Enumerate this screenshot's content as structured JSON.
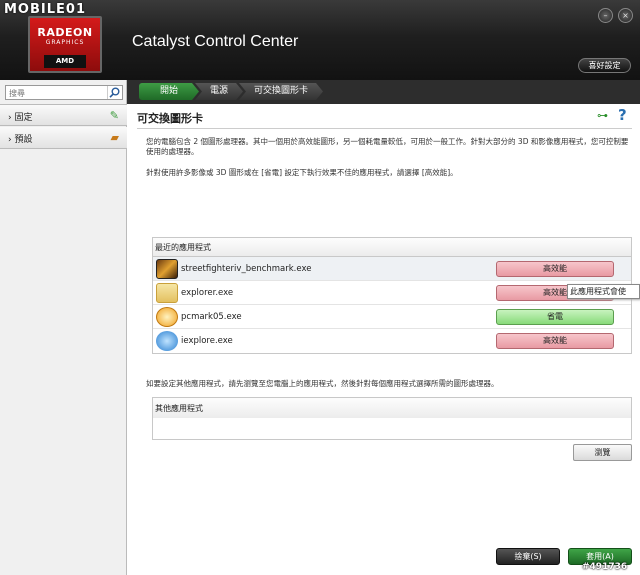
{
  "watermark": "MOBILE01",
  "logo": {
    "line1": "RADEON",
    "line2": "GRAPHICS",
    "brand": "AMD"
  },
  "app_title": "Catalyst Control Center",
  "header": {
    "preferences_label": "喜好設定",
    "minimize": "–",
    "close": "×"
  },
  "sidebar": {
    "search_placeholder": "搜尋",
    "items": [
      {
        "label": "固定"
      },
      {
        "label": "預設"
      }
    ]
  },
  "breadcrumb": [
    "開始",
    "電源",
    "可交換圖形卡"
  ],
  "page": {
    "title": "可交換圖形卡",
    "desc1": "您的電腦包含 2 個圖形處理器。其中一個用於高效能圖形，另一個耗電量較低，可用於一般工作。針對大部分的 3D 和影像應用程式，您可控制要使用的處理器。",
    "desc2": "針對使用許多影像或 3D 圖形或在 [省電] 設定下執行效果不佳的應用程式，請選擇 [高效能]。",
    "recent_header": "最近的應用程式",
    "apps": [
      {
        "name": "streetfighteriv_benchmark.exe",
        "mode": "高效能"
      },
      {
        "name": "explorer.exe",
        "mode": "高效能"
      },
      {
        "name": "pcmark05.exe",
        "mode": "省電"
      },
      {
        "name": "iexplore.exe",
        "mode": "高效能"
      }
    ],
    "tooltip": "此應用程式會使",
    "other_desc": "如要設定其他應用程式，請先瀏覽至您電腦上的應用程式，然後針對每個應用程式選擇所需的圖形處理器。",
    "other_header": "其他應用程式",
    "browse_label": "瀏覽",
    "discard_label": "捨棄(S)",
    "apply_label": "套用(A)"
  },
  "image_id": "#491736"
}
